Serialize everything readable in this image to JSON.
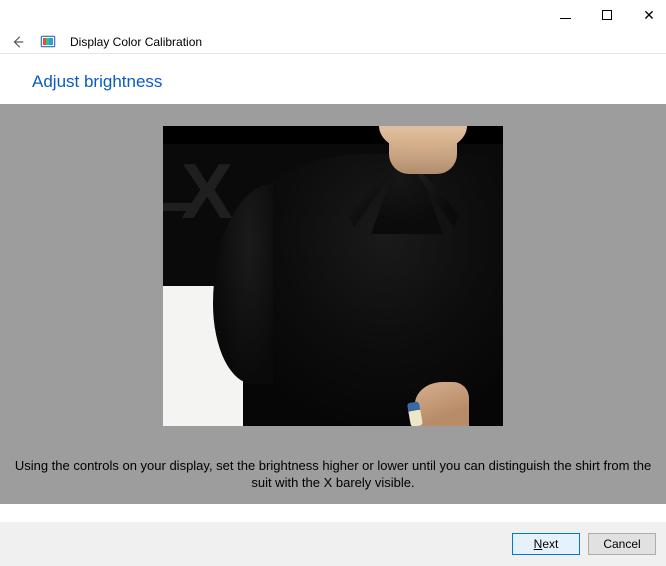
{
  "window": {
    "title": "Display Color Calibration"
  },
  "page": {
    "heading": "Adjust brightness",
    "instruction": "Using the controls on your display, set the brightness higher or lower until you can distinguish the shirt from the suit with the X barely visible."
  },
  "buttons": {
    "next": "Next",
    "next_mnemonic_index": 0,
    "cancel": "Cancel"
  }
}
